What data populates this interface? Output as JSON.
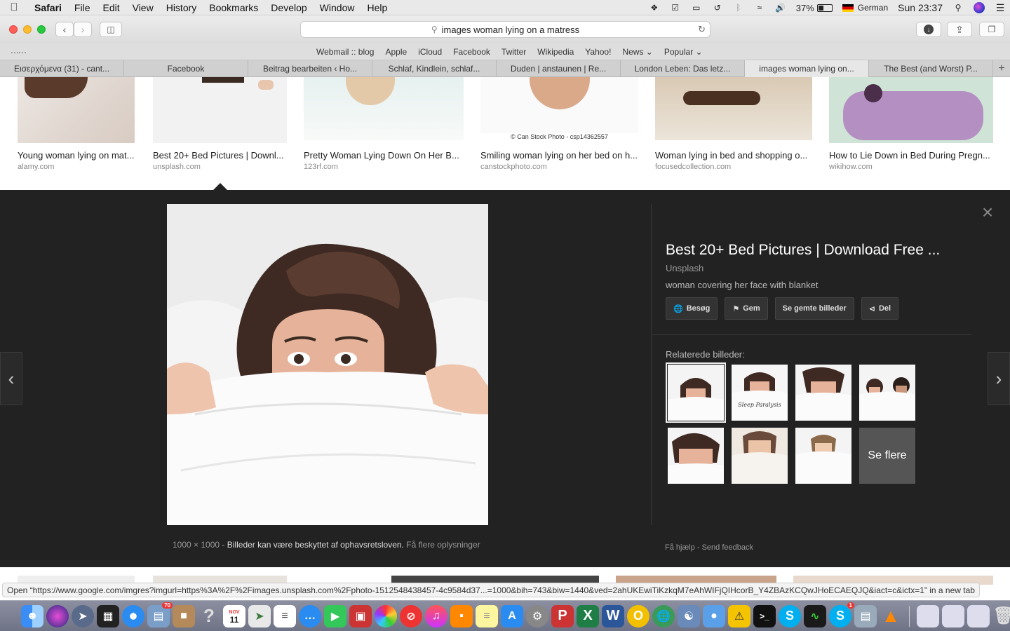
{
  "menubar": {
    "app": "Safari",
    "items": [
      "File",
      "Edit",
      "View",
      "History",
      "Bookmarks",
      "Develop",
      "Window",
      "Help"
    ],
    "battery": "37%",
    "input_source": "German",
    "clock": "Sun 23:37"
  },
  "toolbar": {
    "url": "images woman lying on a matress"
  },
  "favorites": [
    "Webmail :: blog",
    "Apple",
    "iCloud",
    "Facebook",
    "Twitter",
    "Wikipedia",
    "Yahoo!",
    "News ⌄",
    "Popular ⌄"
  ],
  "tabs": [
    "Εισερχόμενα (31) - cant...",
    "Facebook",
    "Beitrag bearbeiten ‹ Ho...",
    "Schlaf, Kindlein, schlaf...",
    "Duden | anstaunen | Re...",
    "London Leben: Das letz...",
    "images woman lying on...",
    "The Best (and Worst) P..."
  ],
  "results": [
    {
      "title": "Young woman lying on mat...",
      "site": "alamy.com"
    },
    {
      "title": "Best 20+ Bed Pictures | Downl...",
      "site": "unsplash.com"
    },
    {
      "title": "Pretty Woman Lying Down On Her B...",
      "site": "123rf.com"
    },
    {
      "title": "Smiling woman lying on her bed on h...",
      "site": "canstockphoto.com",
      "watermark": "© Can Stock Photo - csp14362557"
    },
    {
      "title": "Woman lying in bed and shopping o...",
      "site": "focusedcollection.com"
    },
    {
      "title": "How to Lie Down in Bed During Pregn...",
      "site": "wikihow.com"
    }
  ],
  "preview": {
    "title": "Best 20+ Bed Pictures | Download Free ...",
    "source": "Unsplash",
    "description": "woman covering her face with blanket",
    "actions": [
      "Besøg",
      "Gem",
      "Se gemte billeder",
      "Del"
    ],
    "related_label": "Relaterede billeder:",
    "see_more": "Se flere",
    "size": "1000 × 1000",
    "copyright": "Billeder kan være beskyttet af ophavsretsloven.",
    "more_info": "Få flere oplysninger",
    "help": "Få hjælp",
    "feedback": "Send feedback",
    "sep": "-"
  },
  "status_bar": "Open “https://www.google.com/imgres?imgurl=https%3A%2F%2Fimages.unsplash.com%2Fphoto-1512548438457-4c9584d37...=1000&bih=743&biw=1440&ved=2ahUKEwiTiKzkqM7eAhWIFjQIHcorB_Y4ZBAzKCQwJHoECAEQJQ&iact=c&ictx=1” in a new tab",
  "dock": {
    "calendar_month": "NOV",
    "calendar_day": "11",
    "badge_photos": "70",
    "badge_skype": "1"
  }
}
